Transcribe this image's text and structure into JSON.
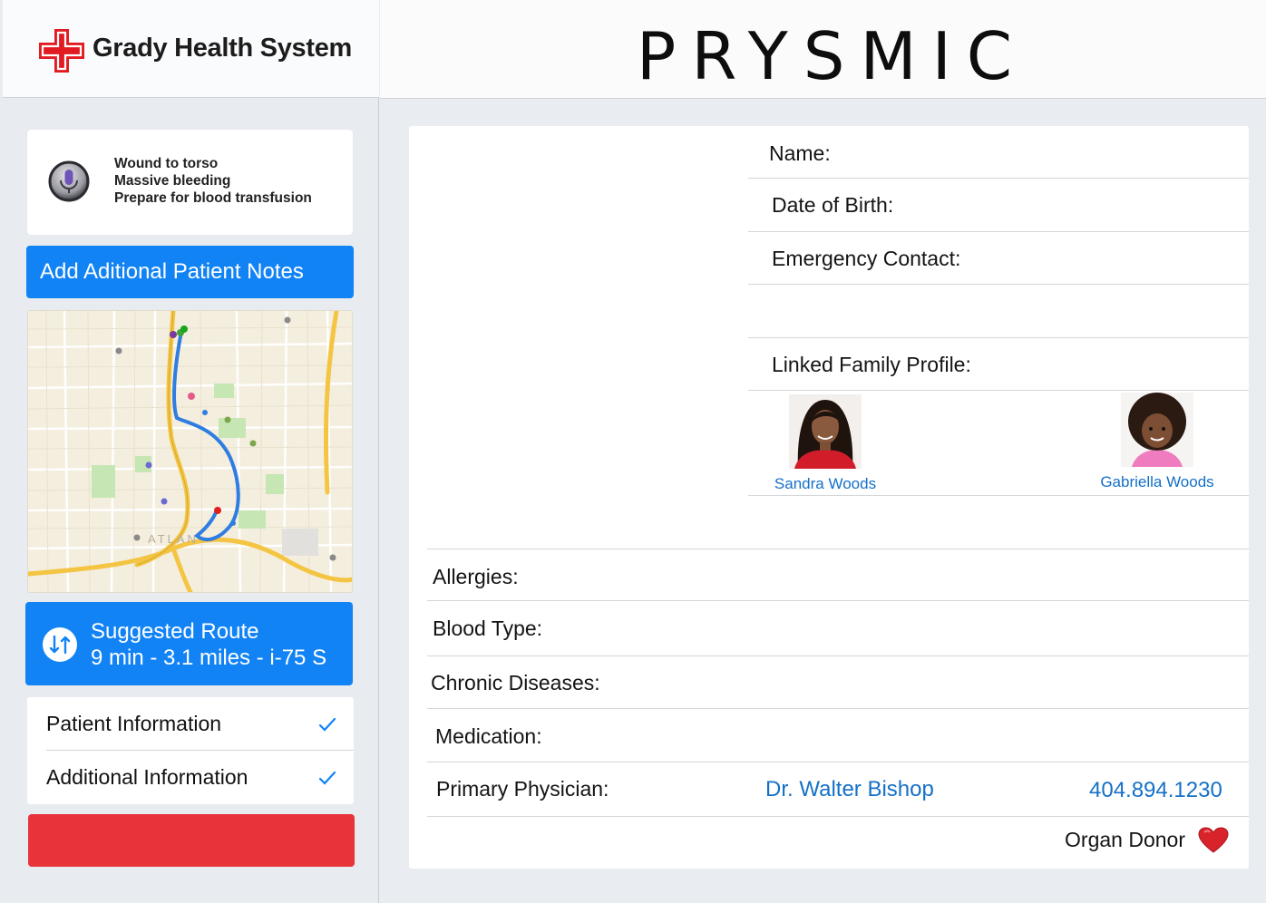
{
  "brand": {
    "name": "Grady Health System"
  },
  "app": {
    "title": "PRYSMIC"
  },
  "notes": {
    "lines": [
      "Wound to torso",
      "Massive bleeding",
      "Prepare for blood transfusion"
    ]
  },
  "actions": {
    "add_notes_label": "Add Aditional Patient Notes"
  },
  "map": {
    "city_label": "ATLAN"
  },
  "route": {
    "title": "Suggested Route",
    "details": "9 min - 3.1 miles - i-75 S"
  },
  "sections": {
    "patient_information": "Patient Information",
    "additional_information": "Additional Information"
  },
  "profile": {
    "name_label": "Name:",
    "dob_label": "Date of Birth:",
    "emergency_label": "Emergency Contact:",
    "family_label": "Linked Family Profile:",
    "family": [
      {
        "name": "Sandra Woods"
      },
      {
        "name": "Gabriella Woods"
      }
    ]
  },
  "medical": {
    "allergies_label": "Allergies:",
    "blood_type_label": "Blood Type:",
    "chronic_label": "Chronic Diseases:",
    "medication_label": "Medication:",
    "physician_label": "Primary Physician:",
    "physician_name": "Dr. Walter Bishop",
    "physician_phone": "404.894.1230",
    "organ_donor_label": "Organ Donor"
  },
  "colors": {
    "accent_blue": "#1283f5",
    "link_blue": "#1570c7",
    "danger_red": "#e8333a",
    "brand_red": "#e21b23"
  },
  "icons": {
    "brand": "red-cross-icon",
    "voice": "microphone-icon",
    "route": "swap-arrows-icon",
    "check": "checkmark-icon",
    "donor": "heart-icon"
  }
}
